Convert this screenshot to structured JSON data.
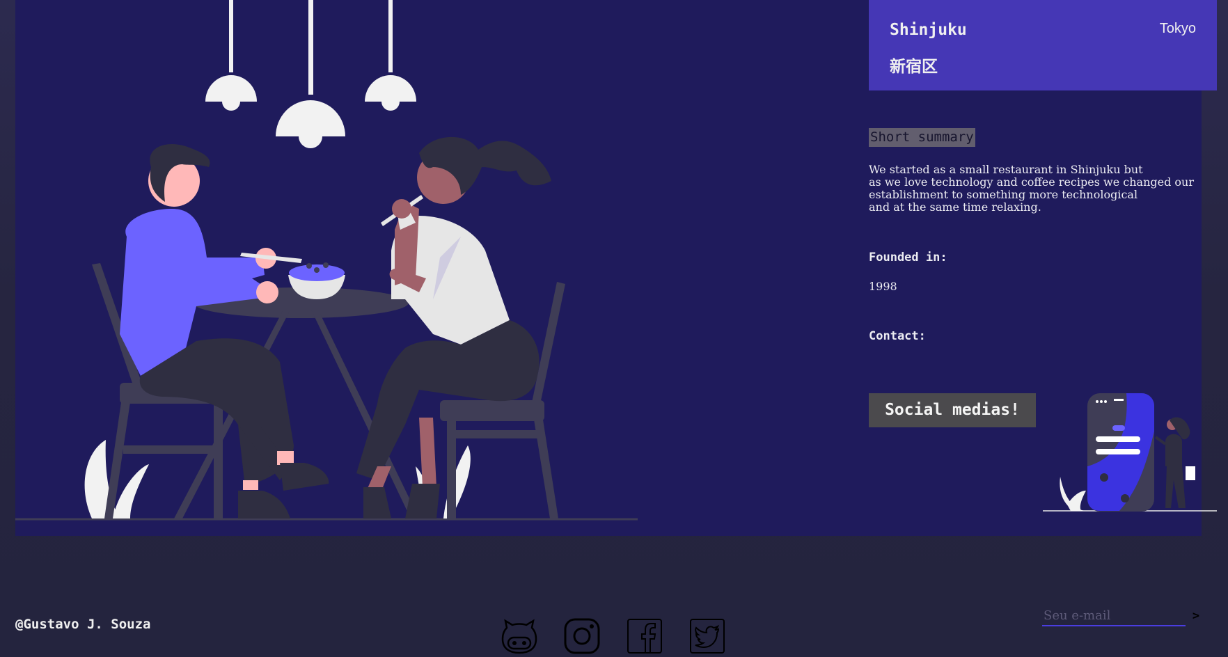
{
  "header": {
    "city": "Shinjuku",
    "city_jp": "新宿区",
    "region": "Tokyo"
  },
  "info": {
    "summary_heading": "Short summary",
    "summary_text": "We started as a small restaurant in Shinjuku but\nas we love technology and coffee recipes we changed our\nestablishment to something more technological\nand at the same time relaxing.",
    "founded_label": "Founded in:",
    "founded_value": "1998",
    "contact_label": "Contact:",
    "social_button": "Social medias!"
  },
  "footer": {
    "author": "@Gustavo J. Souza",
    "socials": [
      "github-icon",
      "instagram-icon",
      "facebook-icon",
      "twitter-icon"
    ],
    "email_placeholder": "Seu e-mail",
    "email_submit": ">"
  },
  "colors": {
    "panel": "#1f1b5c",
    "header": "#4537b5",
    "accent": "#6c63ff",
    "page": "#24243e"
  }
}
